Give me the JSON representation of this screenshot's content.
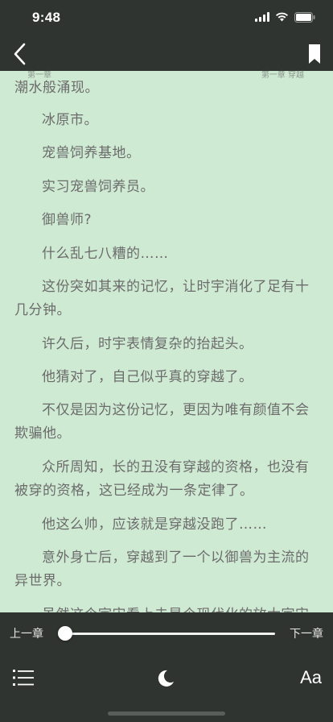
{
  "status_bar": {
    "time": "9:48"
  },
  "header": {
    "chapter_left": "第一章",
    "chapter_right": "第一章 穿越"
  },
  "content": {
    "paragraphs": [
      "下瞬时，他的大脑猛地一抖剧痛，大量的记忆如潮水般涌现。",
      "冰原市。",
      "宠兽饲养基地。",
      "实习宠兽饲养员。",
      "御兽师?",
      "什么乱七八糟的……",
      "这份突如其来的记忆，让时宇消化了足有十几分钟。",
      "许久后，时宇表情复杂的抬起头。",
      "他猜对了，自己似乎真的穿越了。",
      "不仅是因为这份记忆，更因为唯有颜值不会欺骗他。",
      "众所周知，长的丑没有穿越的资格，也没有被穿的资格，这已经成为一条定律了。",
      "他这么帅，应该就是穿越没跑了……",
      "意外身亡后，穿越到了一个以御兽为主流的异世界。",
      "虽然这个宇宙看上去是个现代化的放大宇宙"
    ]
  },
  "controls": {
    "prev_chapter": "上一章",
    "next_chapter": "下一章",
    "progress": 0.0
  },
  "icons": {
    "back": "chevron-left-icon",
    "bookmark": "bookmark-icon",
    "toc": "list-icon",
    "night": "moon-icon",
    "font": "Aa"
  },
  "colors": {
    "page_bg": "#cfead3",
    "overlay": "#2f3431",
    "text": "#6b6b6b"
  }
}
